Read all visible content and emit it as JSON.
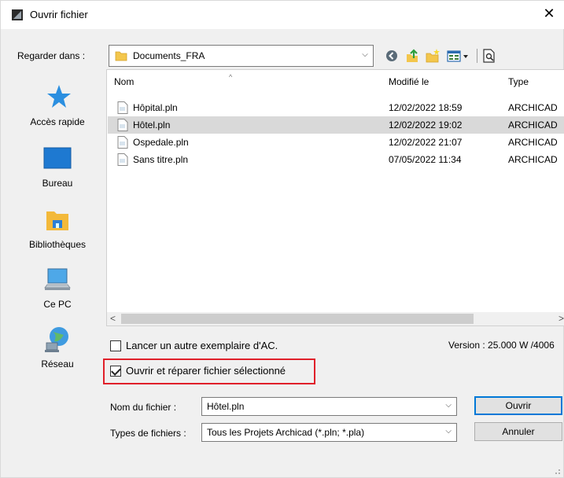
{
  "window": {
    "title": "Ouvrir fichier",
    "close_glyph": "✕"
  },
  "lookin": {
    "label": "Regarder dans :",
    "value": "Documents_FRA",
    "arrow_glyph": "⌵"
  },
  "toolbar": {
    "icons": [
      "back-icon",
      "up-folder-icon",
      "new-folder-icon",
      "view-menu-icon",
      "preview-icon"
    ]
  },
  "places": [
    {
      "label": "Accès rapide",
      "icon": "quick-access-icon"
    },
    {
      "label": "Bureau",
      "icon": "desktop-icon"
    },
    {
      "label": "Bibliothèques",
      "icon": "libraries-icon"
    },
    {
      "label": "Ce PC",
      "icon": "computer-icon"
    },
    {
      "label": "Réseau",
      "icon": "network-icon"
    }
  ],
  "filelist": {
    "columns": {
      "name": "Nom",
      "modified": "Modifié le",
      "type": "Type"
    },
    "rows": [
      {
        "name": "Hôpital.pln",
        "modified": "12/02/2022 18:59",
        "type": "ARCHICAD",
        "selected": false
      },
      {
        "name": "Hôtel.pln",
        "modified": "12/02/2022 19:02",
        "type": "ARCHICAD",
        "selected": true
      },
      {
        "name": "Ospedale.pln",
        "modified": "12/02/2022 21:07",
        "type": "ARCHICAD",
        "selected": false
      },
      {
        "name": "Sans titre.pln",
        "modified": "07/05/2022 11:34",
        "type": "ARCHICAD",
        "selected": false
      }
    ]
  },
  "options": {
    "another_instance": {
      "label": "Lancer un autre exemplaire d'AC.",
      "checked": false
    },
    "open_and_repair": {
      "label": "Ouvrir et réparer fichier sélectionné",
      "checked": true
    },
    "version": "Version : 25.000 W /4006"
  },
  "filename": {
    "label": "Nom du fichier :",
    "value": "Hôtel.pln"
  },
  "filetype": {
    "label": "Types de fichiers :",
    "value": "Tous les Projets Archicad (*.pln; *.pla)"
  },
  "buttons": {
    "open": "Ouvrir",
    "cancel": "Annuler"
  },
  "colors": {
    "selection": "#d9d9d9",
    "highlight_border": "#e0202a",
    "default_button_border": "#0078d7"
  }
}
